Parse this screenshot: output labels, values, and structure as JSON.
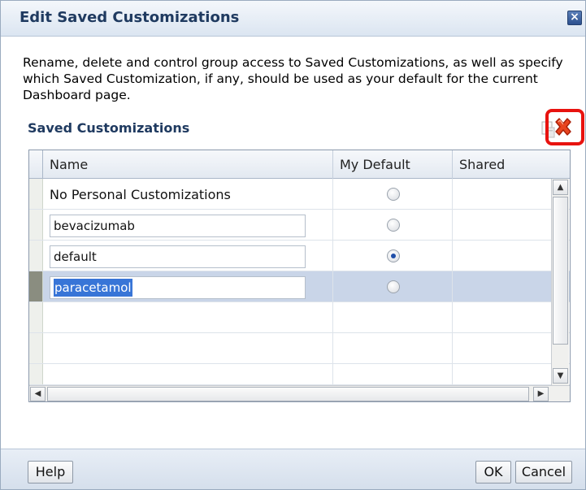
{
  "dialog": {
    "title": "Edit Saved Customizations",
    "close_symbol": "×",
    "description": "Rename, delete and control group access to Saved Customizations, as well as specify which Saved Customization, if any, should be used as your default for the current Dashboard page.",
    "section_title": "Saved Customizations"
  },
  "toolbar": {
    "edit_icon": "edit-permissions-icon",
    "delete_icon": "delete-x-icon",
    "highlight_color": "#e8130f"
  },
  "table": {
    "columns": [
      "Name",
      "My Default",
      "Shared"
    ],
    "rows": [
      {
        "name": "No Personal Customizations",
        "editable": false,
        "default": false
      },
      {
        "name": "bevacizumab",
        "editable": true,
        "default": false
      },
      {
        "name": "default",
        "editable": true,
        "default": true
      },
      {
        "name": "paracetamol",
        "editable": true,
        "default": false,
        "selected": true
      }
    ]
  },
  "footer": {
    "help_label": "Help",
    "ok_label": "OK",
    "cancel_label": "Cancel"
  }
}
